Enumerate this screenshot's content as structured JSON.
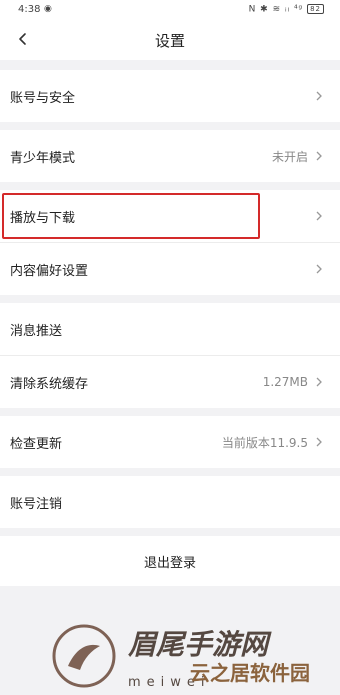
{
  "status_bar": {
    "time": "4:38",
    "eye": "◉",
    "icons": "N ✱ ≋ ᵢₗ ⁴ᵍ",
    "battery": "82"
  },
  "nav": {
    "title": "设置"
  },
  "sections": [
    {
      "rows": [
        {
          "label": "账号与安全",
          "value": ""
        }
      ]
    },
    {
      "rows": [
        {
          "label": "青少年模式",
          "value": "未开启"
        }
      ]
    },
    {
      "rows": [
        {
          "label": "播放与下载",
          "value": ""
        },
        {
          "label": "内容偏好设置",
          "value": ""
        }
      ]
    },
    {
      "rows": [
        {
          "label": "消息推送",
          "value": ""
        },
        {
          "label": "清除系统缓存",
          "value": "1.27MB"
        }
      ]
    },
    {
      "rows": [
        {
          "label": "检查更新",
          "value": "当前版本11.9.5"
        }
      ]
    },
    {
      "rows": [
        {
          "label": "账号注销",
          "value": ""
        }
      ]
    }
  ],
  "logout_label": "退出登录",
  "watermark": {
    "text1": "眉尾手游网",
    "text2": "云之居软件园",
    "text3": "meiwei"
  },
  "colors": {
    "highlight": "#d42a2a",
    "background": "#f2f2f4"
  }
}
